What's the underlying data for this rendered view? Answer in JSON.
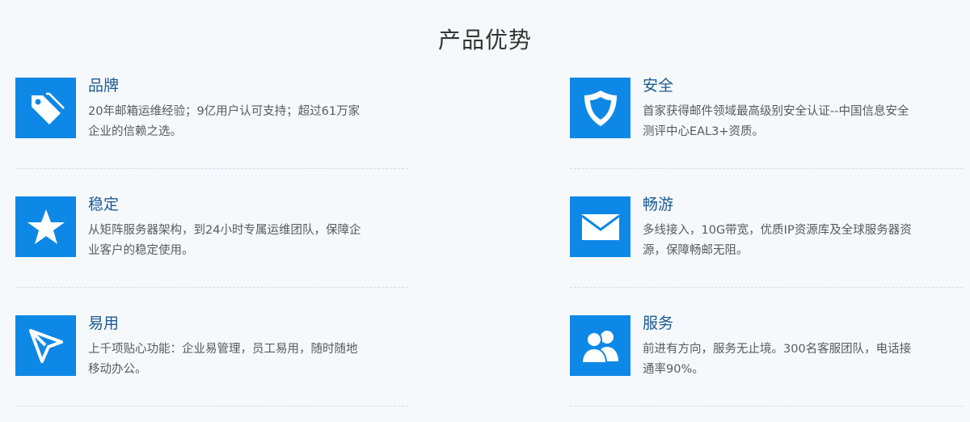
{
  "section": {
    "title": "产品优势"
  },
  "features": [
    {
      "title": "品牌",
      "desc": "20年邮箱运维经验；9亿用户认可支持；超过61万家企业的信赖之选。",
      "icon": "tag-icon"
    },
    {
      "title": "安全",
      "desc": "首家获得邮件领域最高级别安全认证--中国信息安全测评中心EAL3+资质。",
      "icon": "shield-icon"
    },
    {
      "title": "稳定",
      "desc": "从矩阵服务器架构，到24小时专属运维团队，保障企业客户的稳定使用。",
      "icon": "star-icon"
    },
    {
      "title": "畅游",
      "desc": "多线接入，10G带宽，优质IP资源库及全球服务器资源，保障畅邮无阻。",
      "icon": "envelope-icon"
    },
    {
      "title": "易用",
      "desc": "上千项贴心功能：企业易管理，员工易用，随时随地移动办公。",
      "icon": "cursor-arrow-icon"
    },
    {
      "title": "服务",
      "desc": "前进有方向，服务无止境。300名客服团队，电话接通率90%。",
      "icon": "users-icon"
    }
  ],
  "colors": {
    "icon_bg": "#0e88e6",
    "title": "#1b5a93",
    "text": "#555b61",
    "bg": "#f6f9fb"
  }
}
